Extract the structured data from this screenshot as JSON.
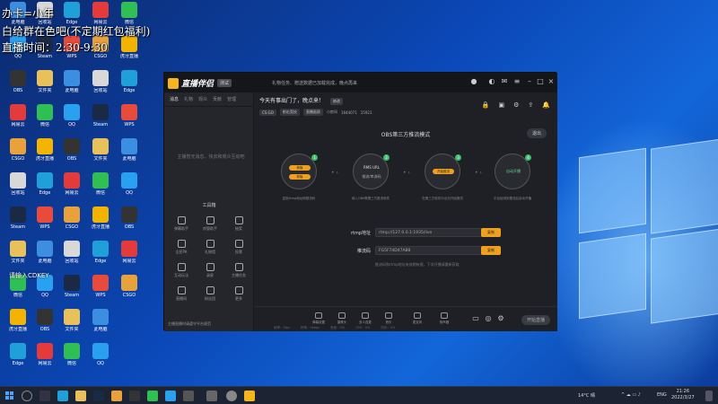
{
  "overlay": {
    "line1": "办卡=小年",
    "line2": "白给群在色吧(不定期红包福利)",
    "line3": "直播时间：2:30-9:30",
    "small": "请输入CDKEY"
  },
  "desktop_icons": [
    {
      "label": "此电脑",
      "color": "#3c8fe0"
    },
    {
      "label": "回收站",
      "color": "#d8d8d8"
    },
    {
      "label": "Edge",
      "color": "#1fa0d8"
    },
    {
      "label": "网易云",
      "color": "#e33b3b"
    },
    {
      "label": "微信",
      "color": "#2fbf55"
    },
    {
      "label": "QQ",
      "color": "#2aa0f0"
    },
    {
      "label": "Steam",
      "color": "#1b2a44"
    },
    {
      "label": "WPS",
      "color": "#e84b3c"
    },
    {
      "label": "CSGO",
      "color": "#e9a23b"
    },
    {
      "label": "虎牙直播",
      "color": "#f2b400"
    },
    {
      "label": "OBS",
      "color": "#333"
    },
    {
      "label": "文件夹",
      "color": "#e8c15a"
    }
  ],
  "app": {
    "logo": "直播伴侣",
    "version": "测试",
    "notice": "礼物任务、赠送数据已加载完成，晚点再来",
    "tabs": [
      "消息",
      "礼物",
      "观众",
      "贡献",
      "管理"
    ],
    "sidebar_empty": "主播暂无消息，快去和观众互动吧",
    "tools_title": "工具箱",
    "tools": [
      "弹幕助手",
      "房管助手",
      "抽奖",
      "全民PK",
      "礼物墙",
      "投票",
      "互动玩法",
      "录屏",
      "主播任务",
      "直播间",
      "粉丝团",
      "更多"
    ],
    "sidebar_footer": "主播直播时请遵守平台规范",
    "room": {
      "title": "今天有事出门了，晚点来！",
      "edit": "修改",
      "category": "CS:GO",
      "tag1": "射击竞技",
      "tag2": "直播画质",
      "room_label": "小房间",
      "viewers": "1644071",
      "fans": "15921"
    },
    "mode_title": "OBS第三方推流模式",
    "exit_label": "退出",
    "steps": [
      {
        "num": "1",
        "label": "",
        "btn1": "获取",
        "btn2": "获取",
        "desc": "复制rtmp地址和推流码"
      },
      {
        "num": "2",
        "label": "RMS URL",
        "sub": "推流/串流码",
        "desc": "填入OBS等第三方推流软件"
      },
      {
        "num": "3",
        "label": "开始推流",
        "desc": "在第三方软件中点击开始推流"
      },
      {
        "num": "4",
        "label": "自动开播",
        "desc": "平台检测到推流后自动开播"
      }
    ],
    "rtmp_label": "rtmp地址",
    "rtmp_value": "rtmp://127.0.0.1:1935/live",
    "key_label": "推流码",
    "key_value": "FG5F74D47A88",
    "copy_label": "复制",
    "field_note": "推流码和rtmp地址有效期有限，下次开播请重新获取",
    "bottom_items": [
      "弹幕设置",
      "摄像头",
      "多人连麦",
      "音乐",
      "麦克风",
      "扬声器"
    ],
    "start_label": "开始直播",
    "stats": [
      "帧率：0fps",
      "码率：0kbps",
      "丢帧：0%",
      "CPU：0%",
      "内存：0%"
    ]
  },
  "taskbar": {
    "weather": "14°C 晴",
    "lang": "ENG",
    "time": "21:26",
    "date": "2022/3/27"
  }
}
